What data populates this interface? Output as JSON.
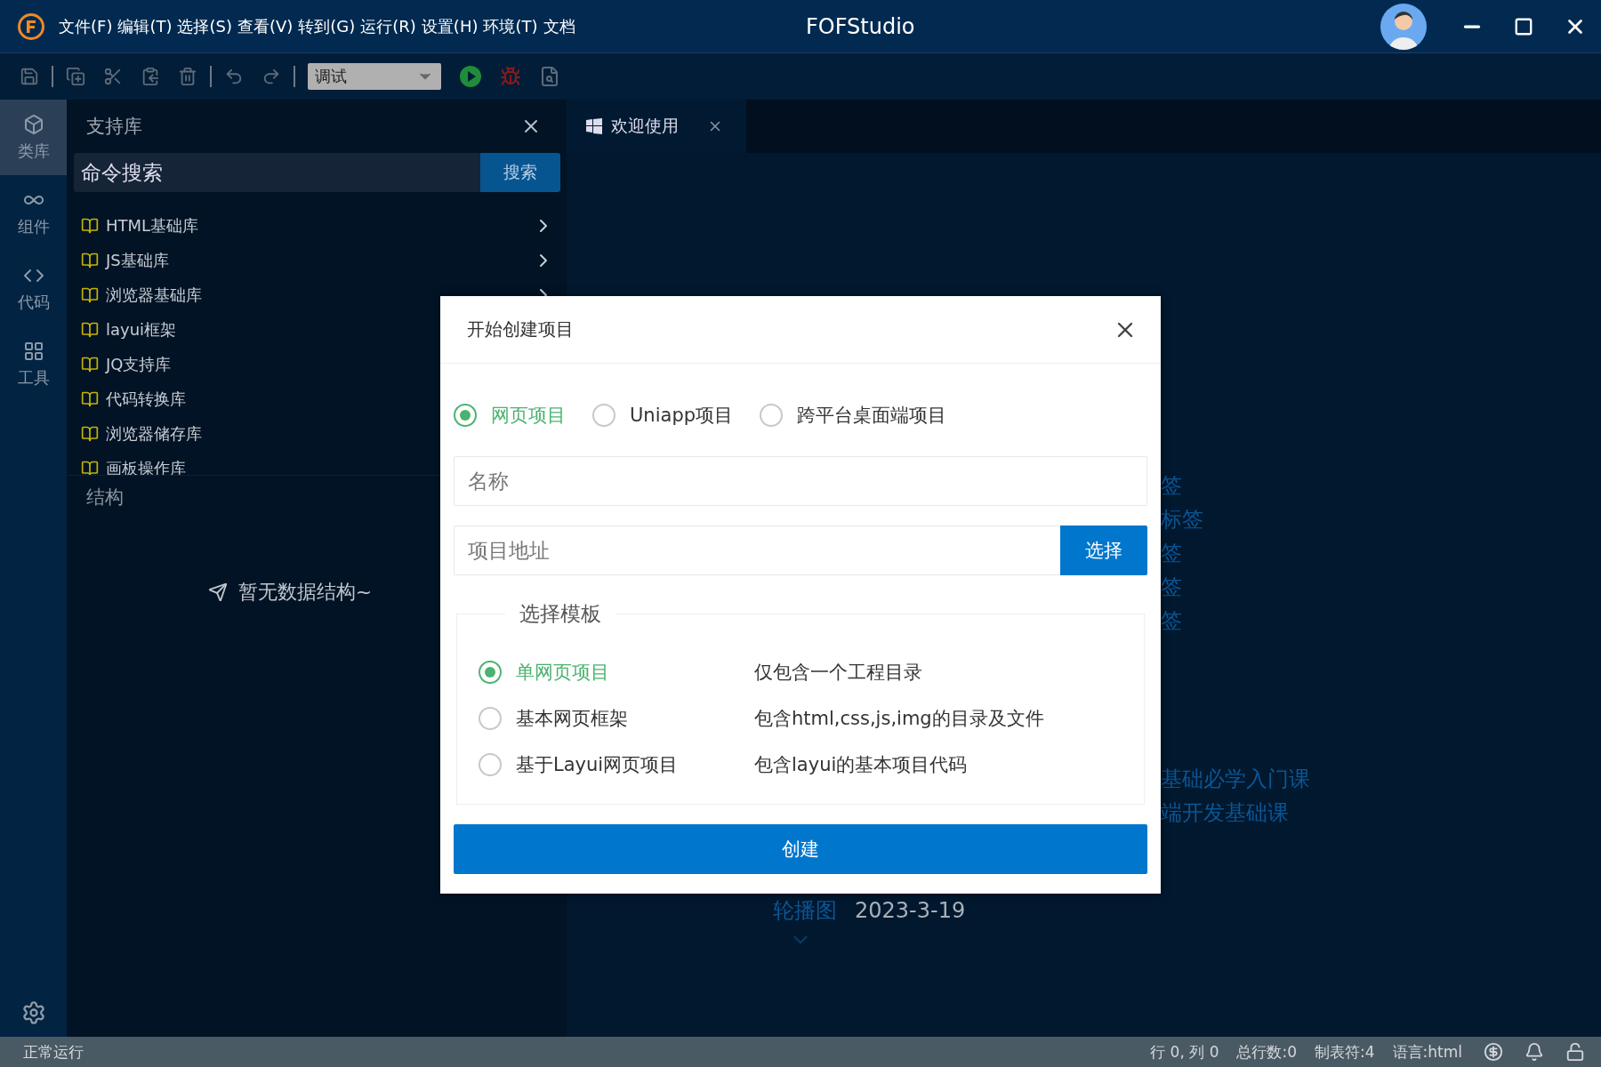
{
  "window": {
    "title": "FOFStudio",
    "menu": [
      "文件(F)",
      "编辑(T)",
      "选择(S)",
      "查看(V)",
      "转到(G)",
      "运行(R)",
      "设置(H)",
      "环境(T)",
      "文档"
    ]
  },
  "toolbar": {
    "mode": "调试"
  },
  "activity_bar": {
    "items": [
      {
        "kind": "library",
        "label": "类库",
        "selected": true
      },
      {
        "kind": "component",
        "label": "组件",
        "selected": false
      },
      {
        "kind": "code",
        "label": "代码",
        "selected": false
      },
      {
        "kind": "tools",
        "label": "工具",
        "selected": false
      }
    ]
  },
  "sidebar": {
    "title": "支持库",
    "search": {
      "placeholder": "命令搜索",
      "button": "搜索"
    },
    "libraries": [
      {
        "label": "HTML基础库",
        "chevron": true
      },
      {
        "label": "JS基础库",
        "chevron": true
      },
      {
        "label": "浏览器基础库",
        "chevron": true
      },
      {
        "label": "layui框架"
      },
      {
        "label": "JQ支持库"
      },
      {
        "label": "代码转换库"
      },
      {
        "label": "浏览器储存库"
      },
      {
        "label": "画板操作库"
      }
    ],
    "structure": {
      "title": "结构",
      "empty": "暂无数据结构~"
    }
  },
  "editor": {
    "tabs": [
      {
        "label": "欢迎使用",
        "selected": true
      }
    ],
    "links": [
      "签",
      "标签",
      "签",
      "签",
      "签"
    ],
    "courses": [
      "基础必学入门课",
      "端开发基础课"
    ],
    "carousel": {
      "label": "轮播图",
      "date": "2023-3-19"
    }
  },
  "dialog": {
    "title": "开始创建项目",
    "project_types": [
      {
        "label": "网页项目",
        "selected": true
      },
      {
        "label": "Uniapp项目",
        "selected": false
      },
      {
        "label": "跨平台桌面端项目",
        "selected": false
      }
    ],
    "name": {
      "placeholder": "名称"
    },
    "address": {
      "placeholder": "项目地址",
      "button": "选择"
    },
    "templates": {
      "legend": "选择模板",
      "items": [
        {
          "label": "单网页项目",
          "description": "仅包含一个工程目录",
          "selected": true
        },
        {
          "label": "基本网页框架",
          "description": "包含html,css,js,img的目录及文件",
          "selected": false
        },
        {
          "label": "基于Layui网页项目",
          "description": "包含layui的基本项目代码",
          "selected": false
        }
      ]
    },
    "submit": "创建"
  },
  "status_bar": {
    "status": "正常运行",
    "items": [
      "行 0, 列 0",
      "总行数:0",
      "制表符:4",
      "语言:html"
    ]
  }
}
